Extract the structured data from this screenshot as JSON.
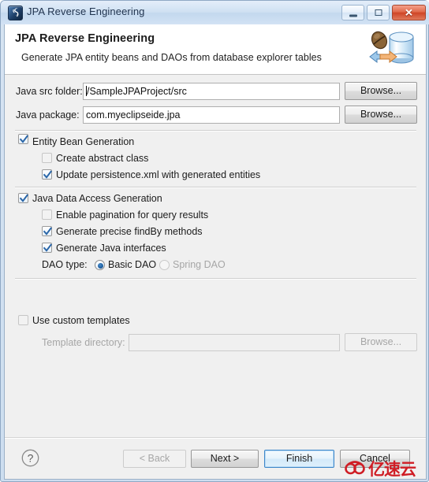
{
  "window": {
    "title": "JPA Reverse Engineering",
    "icon": "jpa-icon",
    "controls": {
      "minimize": "minimize-icon",
      "maximize": "restore-icon",
      "close": "close-icon",
      "close_glyph": "✕"
    }
  },
  "banner": {
    "title": "JPA Reverse Engineering",
    "subtitle": "Generate JPA entity beans and DAOs from database explorer tables",
    "art": "jpa-database-reverse-engineering-icon"
  },
  "fields": {
    "src_folder": {
      "label": "Java src folder:",
      "value": "/SampleJPAProject/src",
      "placeholder": "",
      "browse_label": "Browse..."
    },
    "package": {
      "label": "Java package:",
      "value": "com.myeclipseide.jpa",
      "placeholder": "",
      "browse_label": "Browse..."
    }
  },
  "entity_section": {
    "title": "Entity Bean Generation",
    "checked": true,
    "options": [
      {
        "label": "Create abstract class",
        "checked": false
      },
      {
        "label": "Update persistence.xml with generated entities",
        "checked": true
      }
    ]
  },
  "dao_section": {
    "title": "Java Data Access Generation",
    "checked": true,
    "options": [
      {
        "label": "Enable pagination for query results",
        "checked": false
      },
      {
        "label": "Generate precise findBy methods",
        "checked": true
      },
      {
        "label": "Generate Java interfaces",
        "checked": true
      }
    ],
    "dao_type_label": "DAO type:",
    "dao_types": [
      {
        "label": "Basic DAO",
        "selected": true,
        "enabled": true
      },
      {
        "label": "Spring DAO",
        "selected": false,
        "enabled": false
      }
    ]
  },
  "templates_section": {
    "title": "Use custom templates",
    "checked": false,
    "dir_label": "Template directory:",
    "dir_value": "",
    "dir_placeholder": "",
    "browse_label": "Browse...",
    "enabled": false
  },
  "buttonbar": {
    "help": "help-icon",
    "back": {
      "label": "< Back",
      "enabled": false
    },
    "next": {
      "label": "Next >",
      "enabled": true
    },
    "finish": {
      "label": "Finish",
      "enabled": true,
      "default": true
    },
    "cancel": {
      "label": "Cancel",
      "enabled": true
    }
  },
  "watermark": {
    "text": "亿速云",
    "color": "#cf1d25"
  }
}
